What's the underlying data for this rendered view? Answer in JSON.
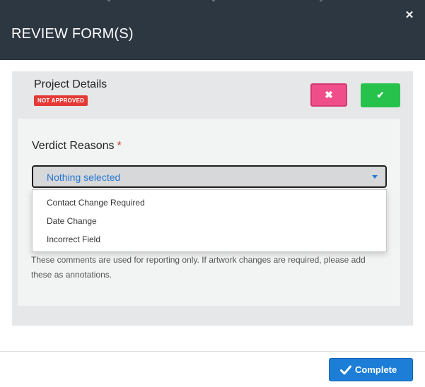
{
  "modal": {
    "title": "REVIEW FORM(S)",
    "close_icon": "close-icon"
  },
  "project": {
    "title": "Project Details",
    "status": "NOT APPROVED",
    "status_color": "#e53935",
    "reject_icon": "x-icon",
    "approve_icon": "check-icon",
    "reject_color": "#f04e8a",
    "approve_color": "#27c24c"
  },
  "verdict": {
    "label": "Verdict Reasons",
    "required_marker": "*",
    "selected_value": "Nothing selected",
    "options": [
      "Contact Change Required",
      "Date Change",
      "Incorrect Field"
    ]
  },
  "comments": {
    "help_text": "These comments are used for reporting only. If artwork changes are required, please add these as annotations."
  },
  "footer": {
    "complete_label": "Complete",
    "complete_color": "#1c7ed6"
  }
}
